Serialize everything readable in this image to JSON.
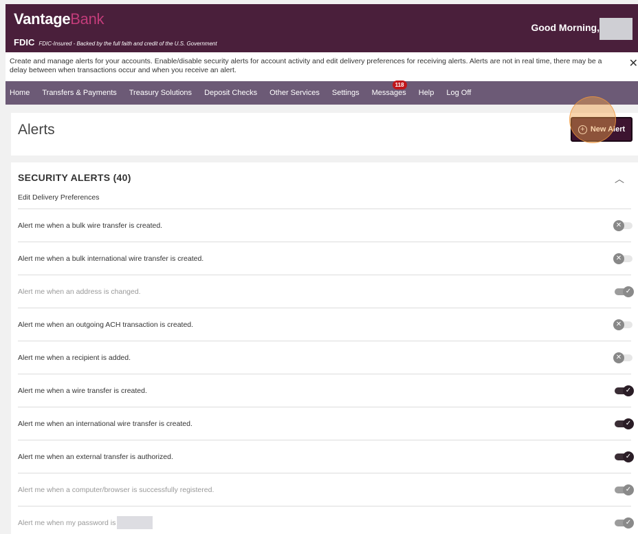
{
  "header": {
    "logo_main": "Vantage",
    "logo_sub": "Bank",
    "fdic_mark": "FDIC",
    "fdic_text": "FDIC-Insured - Backed by the full faith and credit of the U.S. Government",
    "greeting": "Good Morning,"
  },
  "notice": {
    "text": "Create and manage alerts for your accounts. Enable/disable security alerts for account activity and edit delivery preferences for receiving alerts. Alerts are not in real time, there may be a delay between when transactions occur and when you receive an alert.",
    "close_icon": "close-icon"
  },
  "nav": {
    "items": [
      {
        "label": "Home"
      },
      {
        "label": "Transfers & Payments"
      },
      {
        "label": "Treasury Solutions"
      },
      {
        "label": "Deposit Checks"
      },
      {
        "label": "Other Services"
      },
      {
        "label": "Settings"
      },
      {
        "label": "Messages",
        "badge": "118"
      },
      {
        "label": "Help"
      },
      {
        "label": "Log Off"
      }
    ]
  },
  "alerts_header": {
    "title": "Alerts",
    "new_alert_label": "New Alert",
    "new_alert_icon": "plus-circle-icon"
  },
  "security": {
    "title": "SECURITY ALERTS (40)",
    "collapse_icon": "chevron-up-icon",
    "edit_pref": "Edit Delivery Preferences",
    "rows": [
      {
        "label": "Alert me when a bulk wire transfer is created.",
        "enabled": false,
        "muted": false
      },
      {
        "label": "Alert me when a bulk international wire transfer is created.",
        "enabled": false,
        "muted": false
      },
      {
        "label": "Alert me when an address is changed.",
        "enabled": true,
        "muted": true
      },
      {
        "label": "Alert me when an outgoing ACH transaction is created.",
        "enabled": false,
        "muted": false
      },
      {
        "label": "Alert me when a recipient is added.",
        "enabled": false,
        "muted": false
      },
      {
        "label": "Alert me when a wire transfer is created.",
        "enabled": true,
        "muted": false
      },
      {
        "label": "Alert me when an international wire transfer is created.",
        "enabled": true,
        "muted": false
      },
      {
        "label": "Alert me when an external transfer is authorized.",
        "enabled": true,
        "muted": false
      },
      {
        "label": "Alert me when a computer/browser is successfully registered.",
        "enabled": true,
        "muted": true
      },
      {
        "label": "Alert me when my password is",
        "enabled": true,
        "muted": true
      }
    ]
  },
  "colors": {
    "brand_dark": "#4a1f3b",
    "nav_bg": "#6c5a76",
    "brand_accent": "#c23c7a"
  }
}
